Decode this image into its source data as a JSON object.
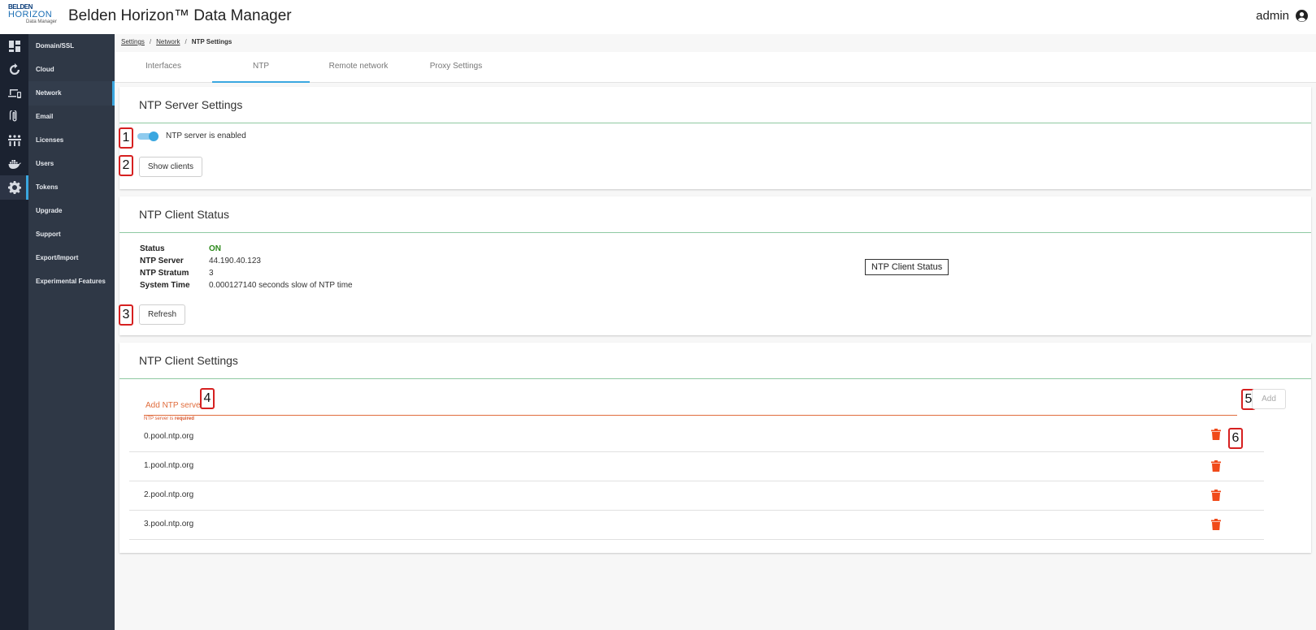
{
  "header": {
    "logo": {
      "line1": "BELDEN",
      "line2": "HORIZON",
      "line3": "Data Manager"
    },
    "title": "Belden Horizon™ Data Manager",
    "user": "admin"
  },
  "rail": {
    "icons": [
      "dashboard-icon",
      "refresh-icon",
      "devices-icon",
      "attachment-icon",
      "network-icon",
      "docker-icon",
      "gear-icon"
    ]
  },
  "sidebar": {
    "items": [
      {
        "label": "Domain/SSL"
      },
      {
        "label": "Cloud"
      },
      {
        "label": "Network"
      },
      {
        "label": "Email"
      },
      {
        "label": "Licenses"
      },
      {
        "label": "Users"
      },
      {
        "label": "Tokens"
      },
      {
        "label": "Upgrade"
      },
      {
        "label": "Support"
      },
      {
        "label": "Export/Import"
      },
      {
        "label": "Experimental Features"
      }
    ]
  },
  "breadcrumb": {
    "settings": "Settings",
    "network": "Network",
    "current": "NTP Settings",
    "separator": "/"
  },
  "tabs": [
    "Interfaces",
    "NTP",
    "Remote network",
    "Proxy Settings"
  ],
  "server_settings": {
    "title": "NTP Server Settings",
    "toggle_label": "NTP server is enabled",
    "toggle_on": true,
    "show_clients": "Show clients"
  },
  "client_status": {
    "title": "NTP Client Status",
    "fields": [
      {
        "label": "Status",
        "value": "ON"
      },
      {
        "label": "NTP Server",
        "value": "44.190.40.123"
      },
      {
        "label": "NTP Stratum",
        "value": "3"
      },
      {
        "label": "System Time",
        "value": "0.000127140 seconds slow of NTP time"
      }
    ],
    "tooltip": "NTP Client Status",
    "refresh": "Refresh"
  },
  "client_settings": {
    "title": "NTP Client Settings",
    "input_placeholder": "Add NTP server",
    "error_prefix": "NTP server is ",
    "error_bold": "required",
    "add": "Add",
    "servers": [
      "0.pool.ntp.org",
      "1.pool.ntp.org",
      "2.pool.ntp.org",
      "3.pool.ntp.org"
    ]
  },
  "markers": [
    "1",
    "2",
    "3",
    "4",
    "5",
    "6"
  ],
  "colors": {
    "accent": "#3aa7e0",
    "status_on": "#2d8a1c",
    "error": "#e06c3c",
    "delete": "#f04a1a",
    "rail_bg": "#1b2230",
    "sidebar_bg": "#2f3846"
  }
}
